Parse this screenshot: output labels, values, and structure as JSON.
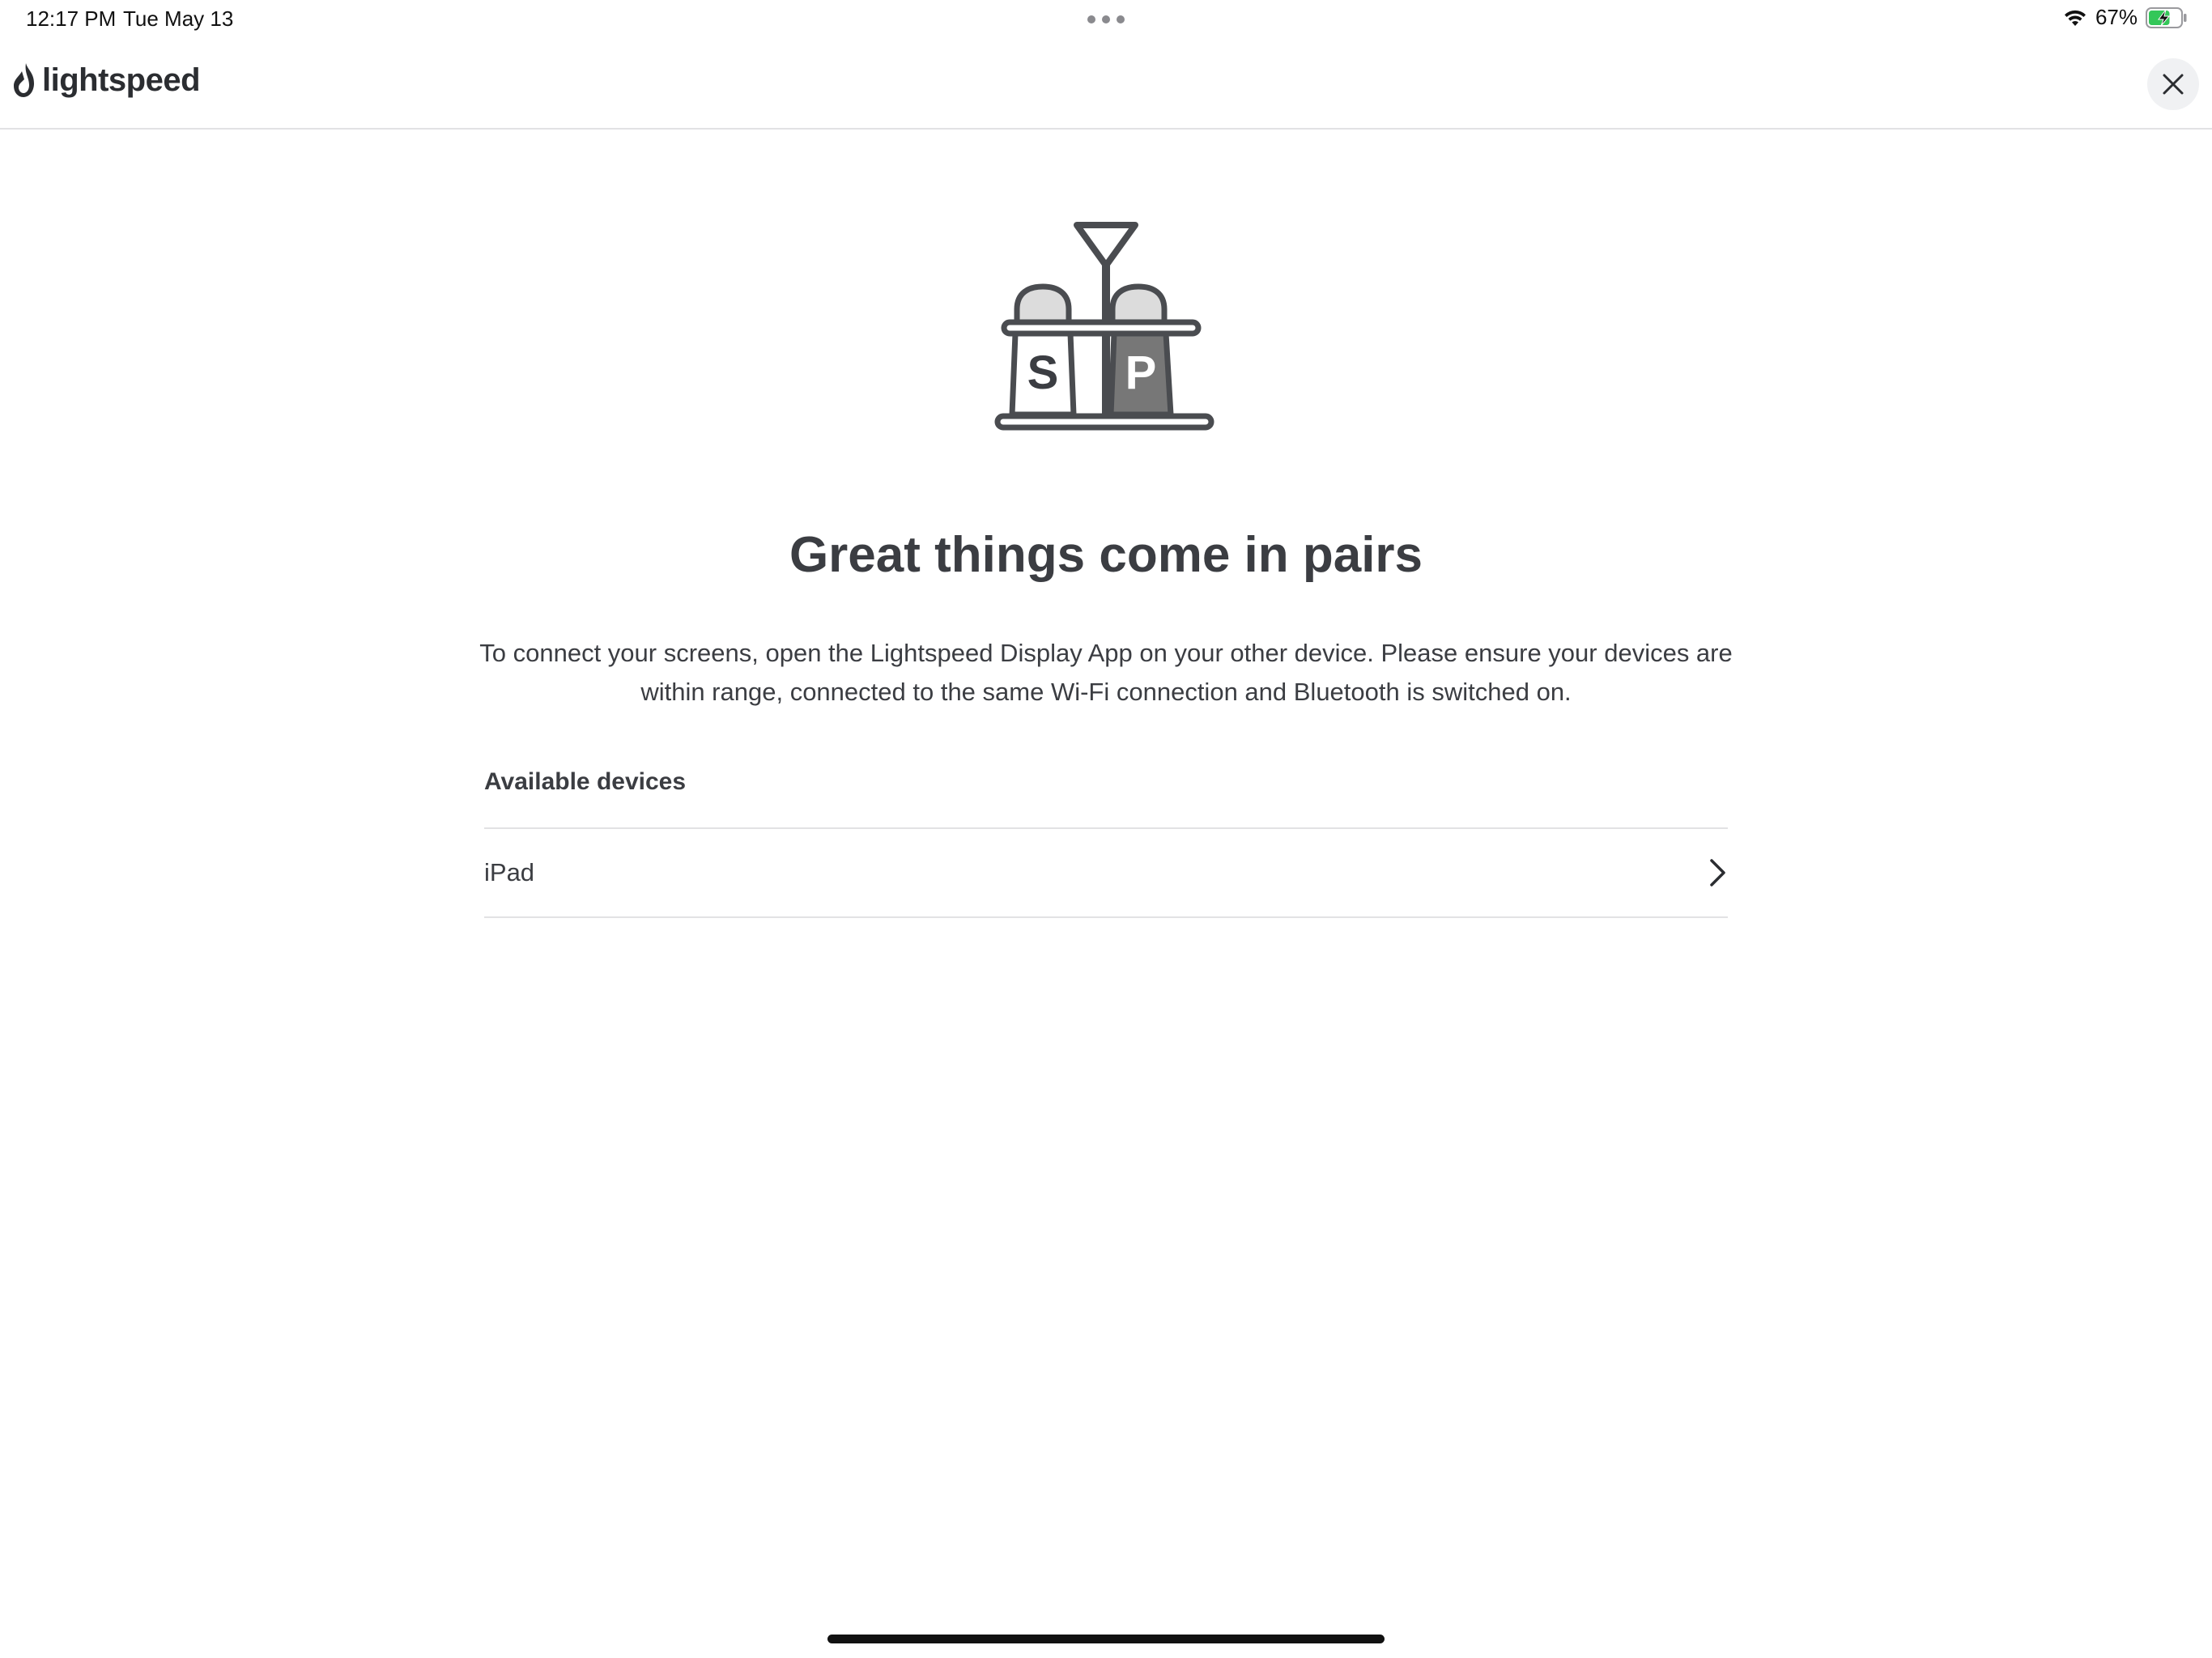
{
  "status_bar": {
    "time": "12:17 PM",
    "date": "Tue May 13",
    "battery_percent": "67%",
    "battery_level": 0.67,
    "icons": [
      "wifi-icon",
      "battery-charging-icon"
    ]
  },
  "header": {
    "logo_text": "lightspeed",
    "close_icon": "close-icon"
  },
  "main": {
    "illustration_icon": "salt-pepper-shakers-icon",
    "illustration_letters": {
      "salt": "S",
      "pepper": "P"
    },
    "title": "Great things come in pairs",
    "description": "To connect your screens, open the Lightspeed Display App on your other device. Please ensure your devices are within range, connected to the same Wi-Fi connection and Bluetooth is switched on.",
    "devices_heading": "Available devices",
    "devices": [
      {
        "name": "iPad",
        "icon": "chevron-right-icon"
      }
    ]
  },
  "colors": {
    "text": "#3b3d42",
    "divider": "#e2e2e4",
    "battery_green": "#34c759",
    "pepper_fill": "#777777",
    "salt_cap": "#dcdcdc"
  }
}
